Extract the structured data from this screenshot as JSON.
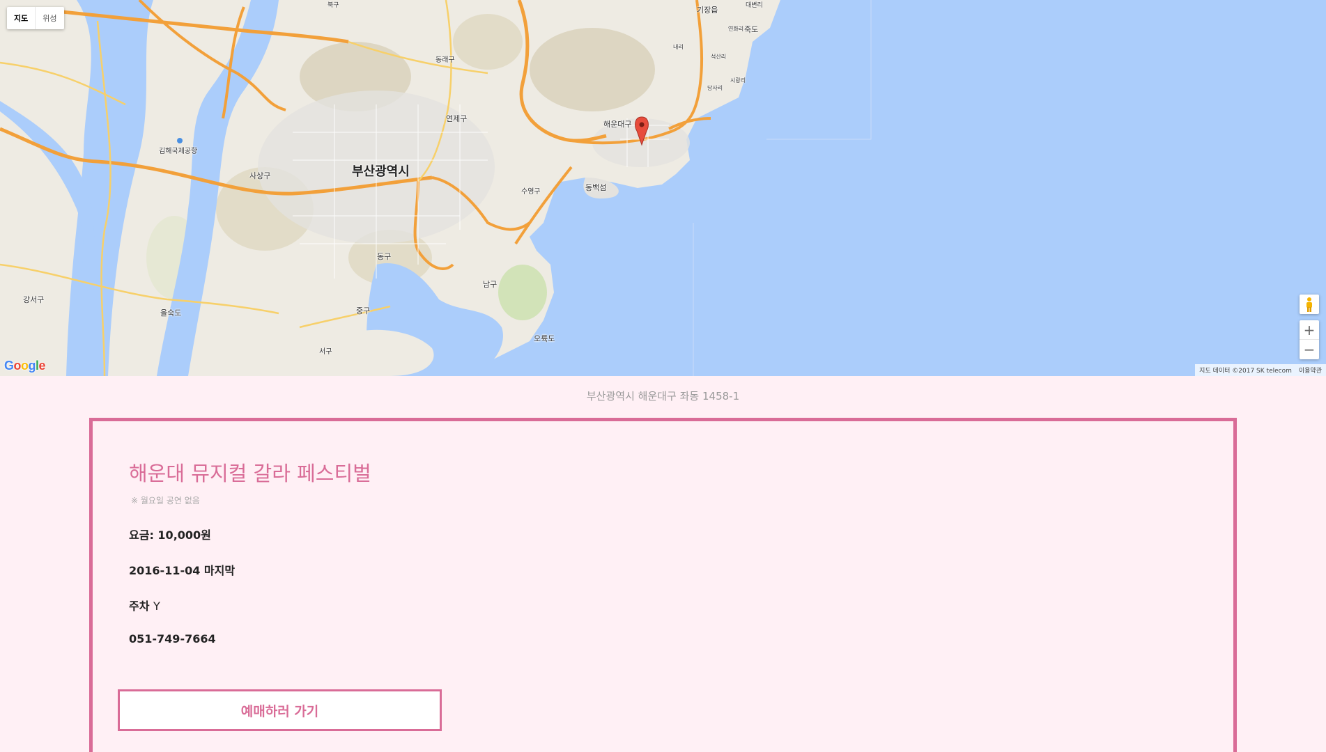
{
  "map": {
    "type_buttons": [
      "지도",
      "위성"
    ],
    "labels": [
      {
        "text": "부산광역시",
        "cls": "big"
      },
      {
        "text": "김해국제공항"
      },
      {
        "text": "사상구"
      },
      {
        "text": "동래구"
      },
      {
        "text": "연제구"
      },
      {
        "text": "해운대구"
      },
      {
        "text": "동백섬"
      },
      {
        "text": "수영구"
      },
      {
        "text": "동구"
      },
      {
        "text": "남구"
      },
      {
        "text": "중구"
      },
      {
        "text": "서구"
      },
      {
        "text": "오륙도"
      },
      {
        "text": "강서구"
      },
      {
        "text": "을숙도"
      },
      {
        "text": "기장읍"
      },
      {
        "text": "죽도"
      },
      {
        "text": "대변리"
      },
      {
        "text": "연화리"
      },
      {
        "text": "석산리"
      },
      {
        "text": "내리"
      },
      {
        "text": "당사리"
      },
      {
        "text": "시랑리"
      },
      {
        "text": "북구"
      }
    ],
    "zoom_in": "+",
    "zoom_out": "−",
    "logo": "Google",
    "attribution": "지도 데이터 ©2017 SK telecom",
    "terms": "이용약관"
  },
  "address": "부산광역시 해운대구 좌동 1458-1",
  "event": {
    "title": "해운대 뮤지컬 갈라 페스티벌",
    "note": "※ 월요일 공연 없음",
    "price_label": "요금:",
    "price_value": "10,000원",
    "date_text": "2016-11-04 마지막",
    "parking_label": "주차",
    "parking_value": "Y",
    "phone": "051-749-7664",
    "book_label": "예매하러 가기"
  },
  "colors": {
    "accent": "#d96c97",
    "background": "#fff0f5",
    "sea": "#abcdfb",
    "land": "#eeebe3",
    "road": "#f2a03a"
  }
}
